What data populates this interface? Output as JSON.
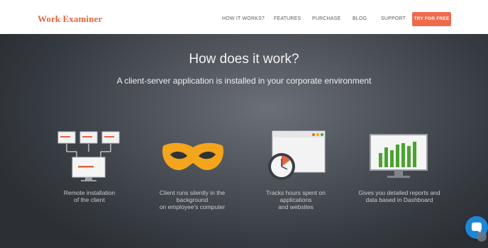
{
  "header": {
    "logo": "Work Examiner",
    "nav": [
      {
        "label": "HOW IT WORKS?"
      },
      {
        "label": "FEATURES"
      },
      {
        "label": "PURCHASE"
      },
      {
        "label": "BLOG"
      },
      {
        "label": "SUPPORT"
      }
    ],
    "cta_label": "TRY FOR FREE"
  },
  "hero": {
    "title": "How does it work?",
    "subtitle": "A client-server application is installed in your corporate environment"
  },
  "features": [
    {
      "icon": "network-computers-icon",
      "lines": [
        "Remote installation",
        "of the client"
      ]
    },
    {
      "icon": "mask-icon",
      "lines": [
        "Client runs silently in the",
        "background",
        "on employee's computer"
      ]
    },
    {
      "icon": "browser-clock-icon",
      "lines": [
        "Tracks hours spent on",
        "applications",
        "and websites"
      ]
    },
    {
      "icon": "dashboard-chart-icon",
      "lines": [
        "Gives you detailed reports and",
        "data based in Dashboard"
      ]
    }
  ],
  "colors": {
    "brand": "#e2663f",
    "cta": "#ef6a4c",
    "chat": "#1e86d6"
  },
  "chat_widget": {
    "icon": "chat-bubble-icon"
  }
}
